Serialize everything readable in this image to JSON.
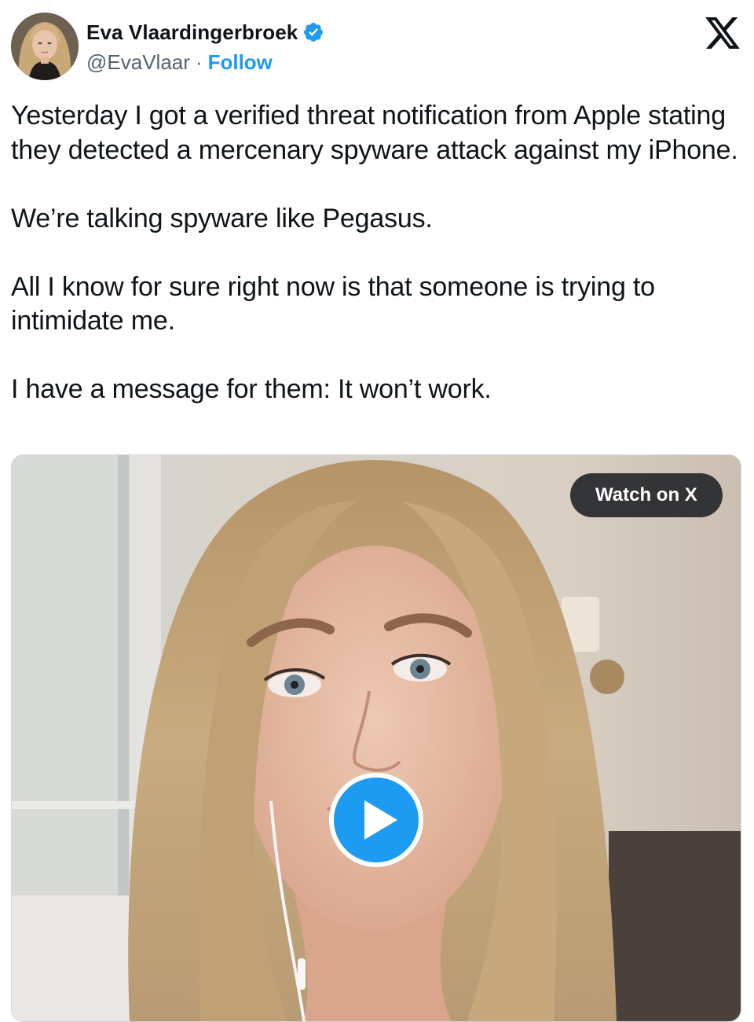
{
  "author": {
    "display_name": "Eva Vlaardingerbroek",
    "handle": "@EvaVlaar",
    "separator": "·",
    "follow_label": "Follow",
    "verified": true
  },
  "platform": {
    "logo_icon": "x-logo-icon"
  },
  "tweet": {
    "text": "Yesterday I got a verified threat notification from Apple stating they detected a mercenary spyware attack against my iPhone.\n\nWe’re talking spyware like Pegasus.\n\nAll I know for sure right now is that someone is trying to intimidate me.\n\nI have a message for them: It won’t work."
  },
  "media": {
    "type": "video",
    "watch_label": "Watch on X",
    "play_icon": "play-icon"
  },
  "colors": {
    "accent": "#1d9bf0",
    "text": "#0f1419",
    "secondary": "#536471"
  }
}
